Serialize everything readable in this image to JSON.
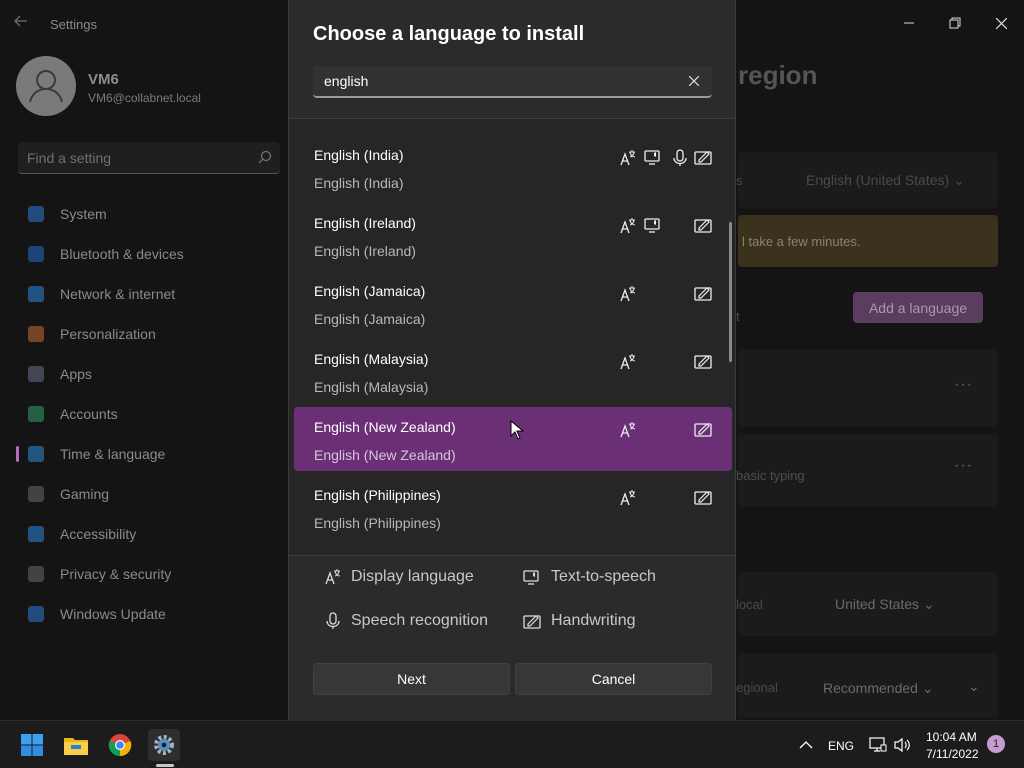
{
  "settings": {
    "app_title": "Settings",
    "user": {
      "name": "VM6",
      "email": "VM6@collabnet.local"
    },
    "search_placeholder": "Find a setting",
    "nav": [
      {
        "label": "System",
        "icon": "monitor-icon",
        "color": "#2b7bd6"
      },
      {
        "label": "Bluetooth & devices",
        "icon": "bluetooth-icon",
        "color": "#1f6fc9"
      },
      {
        "label": "Network & internet",
        "icon": "wifi-icon",
        "color": "#2a86d8"
      },
      {
        "label": "Personalization",
        "icon": "brush-icon",
        "color": "#c86a3a"
      },
      {
        "label": "Apps",
        "icon": "apps-icon",
        "color": "#6b6f8a"
      },
      {
        "label": "Accounts",
        "icon": "person-icon",
        "color": "#2f9c6a"
      },
      {
        "label": "Time & language",
        "icon": "globe-clock-icon",
        "color": "#2b8ad4"
      },
      {
        "label": "Gaming",
        "icon": "gamepad-icon",
        "color": "#6a6a6a"
      },
      {
        "label": "Accessibility",
        "icon": "accessibility-icon",
        "color": "#2a86d8"
      },
      {
        "label": "Privacy & security",
        "icon": "shield-icon",
        "color": "#6a6a6a"
      },
      {
        "label": "Windows Update",
        "icon": "update-icon",
        "color": "#2b7bd6"
      }
    ],
    "active_nav": "Time & language",
    "page_heading": "region",
    "background": {
      "display_lang_value": "English (United States)",
      "warning": "l take a few minutes.",
      "add_language": "Add a language",
      "typing_text": "basic typing",
      "region_label": "local",
      "region_value": "United States",
      "regional_label": "egional",
      "regional_value": "Recommended",
      "fragment_s": "s",
      "fragment_t": "t"
    }
  },
  "dialog": {
    "title": "Choose a language to install",
    "search_value": "english",
    "languages": [
      {
        "name": "English (India)",
        "native": "English (India)",
        "caps": [
          "display",
          "tts",
          "speech",
          "handwriting"
        ]
      },
      {
        "name": "English (Ireland)",
        "native": "English (Ireland)",
        "caps": [
          "display",
          "tts",
          "handwriting"
        ]
      },
      {
        "name": "English (Jamaica)",
        "native": "English (Jamaica)",
        "caps": [
          "display",
          "handwriting"
        ]
      },
      {
        "name": "English (Malaysia)",
        "native": "English (Malaysia)",
        "caps": [
          "display",
          "handwriting"
        ]
      },
      {
        "name": "English (New Zealand)",
        "native": "English (New Zealand)",
        "caps": [
          "display",
          "handwriting"
        ],
        "selected": true
      },
      {
        "name": "English (Philippines)",
        "native": "English (Philippines)",
        "caps": [
          "display",
          "handwriting"
        ]
      }
    ],
    "legend": {
      "display": "Display language",
      "tts": "Text-to-speech",
      "speech": "Speech recognition",
      "handwriting": "Handwriting"
    },
    "next_label": "Next",
    "cancel_label": "Cancel"
  },
  "taskbar": {
    "lang": "ENG",
    "time": "10:04 AM",
    "date": "7/11/2022",
    "notifications": "1"
  },
  "colors": {
    "accent": "#6b2f76",
    "dialog_bg": "#2b2b2b"
  }
}
